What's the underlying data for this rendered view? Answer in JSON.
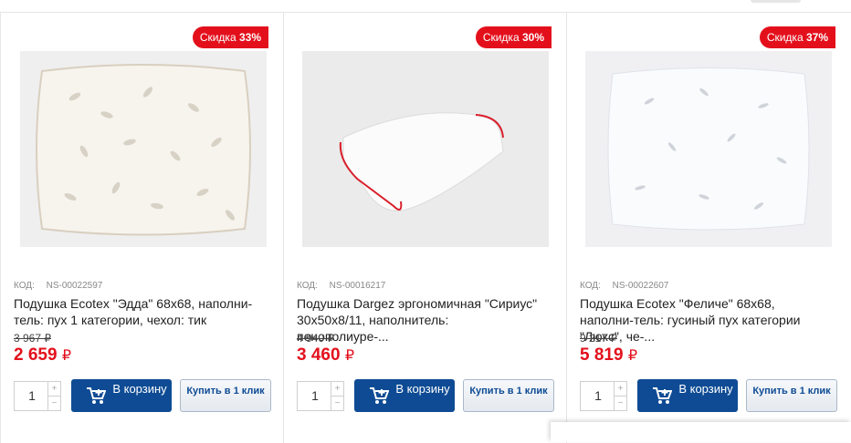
{
  "products": [
    {
      "discount_label": "Скидка",
      "discount_value": "33%",
      "code_label": "КОД:",
      "code": "NS-00022597",
      "title": "Подушка Ecotex \"Эдда\" 68х68, наполни-тель: пух 1 категории, чехол: тик",
      "old_price": "3 967 ₽",
      "price": "2 659",
      "currency": "₽",
      "quantity": "1",
      "cart_label": "В корзину",
      "one_click_label": "Купить в 1 клик",
      "image_icon": "square-pillow-image"
    },
    {
      "discount_label": "Скидка",
      "discount_value": "30%",
      "code_label": "КОД:",
      "code": "NS-00016217",
      "title": "Подушка Dargez эргономичная \"Сириус\" 30х50х8/11, наполнитель: пенополиуре-...",
      "old_price": "4 940 ₽",
      "price": "3 460",
      "currency": "₽",
      "quantity": "1",
      "cart_label": "В корзину",
      "one_click_label": "Купить в 1 клик",
      "image_icon": "ergonomic-pillow-image"
    },
    {
      "discount_label": "Скидка",
      "discount_value": "37%",
      "code_label": "КОД:",
      "code": "NS-00022607",
      "title": "Подушка Ecotex \"Феличе\" 68х68, наполни-тель: гусиный пух категории \"Люкс\", че-...",
      "old_price": "9 217 ₽",
      "price": "5 819",
      "currency": "₽",
      "quantity": "1",
      "cart_label": "В корзину",
      "one_click_label": "Купить в 1 клик",
      "image_icon": "square-pillow-image"
    }
  ],
  "colors": {
    "accent_red": "#e3101c",
    "brand_blue": "#0e4b94"
  }
}
